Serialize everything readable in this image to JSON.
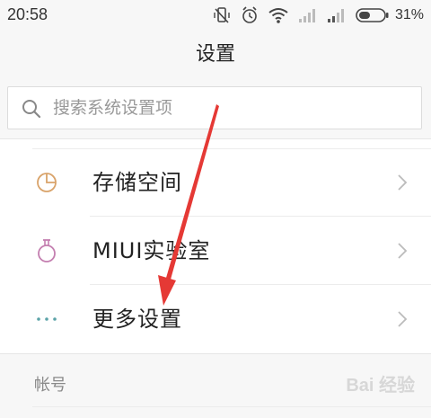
{
  "status_bar": {
    "time": "20:58",
    "battery_percent": "31%",
    "icons": [
      "vibrate-off-icon",
      "alarm-icon",
      "wifi-icon",
      "signal-icon",
      "signal-icon",
      "battery-icon"
    ]
  },
  "header": {
    "title": "设置"
  },
  "search": {
    "placeholder": "搜索系统设置项",
    "value": ""
  },
  "settings_list": {
    "items": [
      {
        "label": "存储空间",
        "icon": "storage-pie-icon"
      },
      {
        "label": "MIUI实验室",
        "icon": "lab-flask-icon"
      },
      {
        "label": "更多设置",
        "icon": "more-dots-icon"
      }
    ]
  },
  "sections": {
    "account_header": "帐号"
  },
  "watermark": {
    "text": "Bai 经验"
  },
  "colors": {
    "background": "#f7f7f7",
    "annotation_arrow": "#e53935",
    "storage_icon": "#d9a36a",
    "lab_icon": "#c47fb0",
    "more_icon": "#5ba3a8"
  }
}
